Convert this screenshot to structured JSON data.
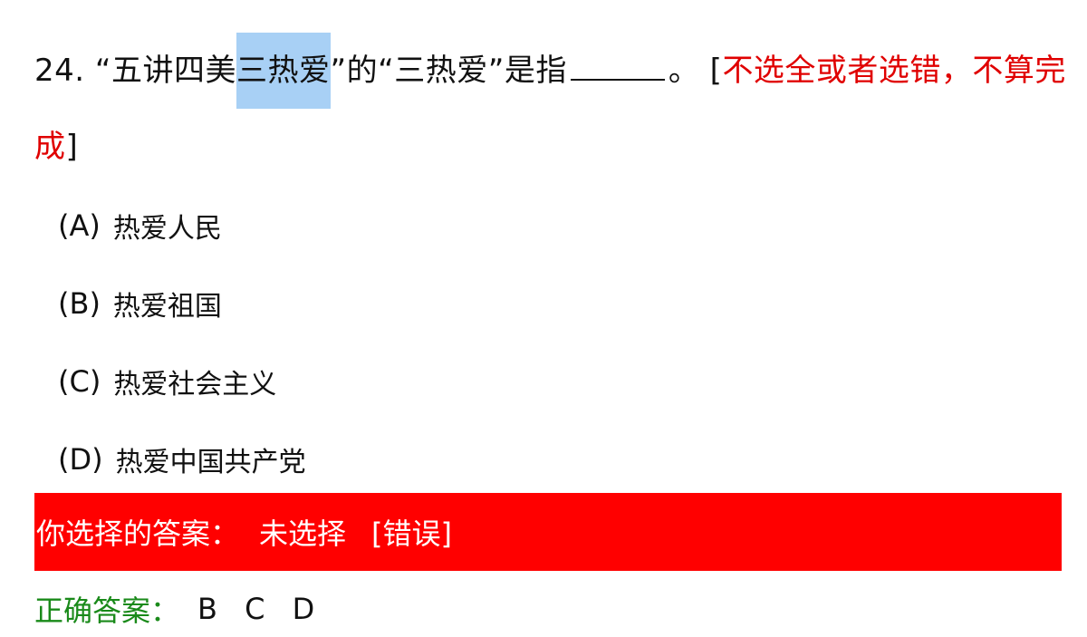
{
  "question": {
    "number": "24.",
    "text_before": "“五讲四美",
    "highlighted": "三热爱",
    "text_after": "”的“三热爱”是指",
    "period": "。",
    "note_open": "[",
    "note": "不选全或者选错，不算完成",
    "note_close": "]"
  },
  "options": [
    {
      "letter": "(A)",
      "text": "热爱人民"
    },
    {
      "letter": "(B)",
      "text": "热爱祖国"
    },
    {
      "letter": "(C)",
      "text": "热爱社会主义"
    },
    {
      "letter": "(D)",
      "text": "热爱中国共产党"
    }
  ],
  "your_answer": {
    "label": "你选择的答案：",
    "value": "未选择",
    "result": "[错误]"
  },
  "correct_answer": {
    "label": "正确答案：",
    "value": "B C D"
  },
  "colors": {
    "highlight": "#a8d0f5",
    "note_red": "#e00000",
    "wrong_bar": "#ff0000",
    "correct_green": "#1a8a1a"
  }
}
